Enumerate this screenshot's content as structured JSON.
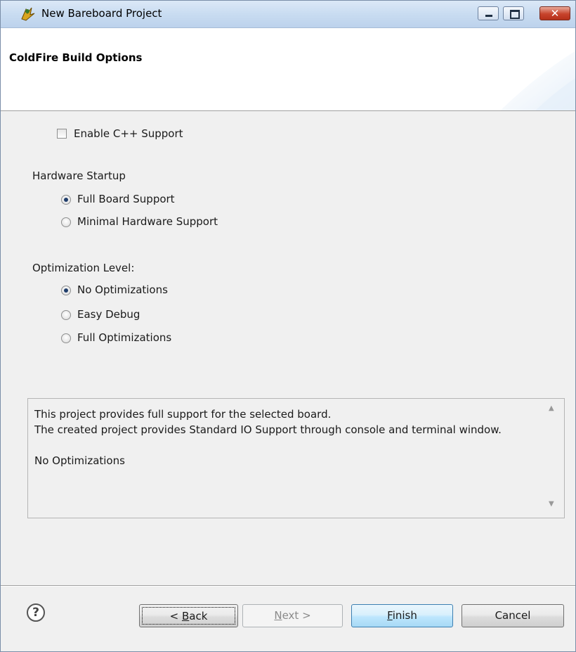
{
  "window": {
    "title": "New Bareboard Project",
    "controls": {
      "minimize": "minimize",
      "maximize": "maximize",
      "close": "✕"
    }
  },
  "header": {
    "title": "ColdFire Build Options"
  },
  "options": {
    "enable_cpp": {
      "label": "Enable C++ Support",
      "checked": false
    },
    "hardware_startup": {
      "heading": "Hardware Startup",
      "choices": [
        {
          "label": "Full Board Support",
          "selected": true
        },
        {
          "label": "Minimal Hardware Support",
          "selected": false
        }
      ]
    },
    "optimization": {
      "heading": "Optimization Level:",
      "choices": [
        {
          "label": "No Optimizations",
          "selected": true
        },
        {
          "label": "Easy Debug",
          "selected": false
        },
        {
          "label": "Full Optimizations",
          "selected": false
        }
      ]
    }
  },
  "description": {
    "lines": [
      "This project provides full support for the selected board.",
      "The created project provides Standard IO Support through console and terminal window.",
      "",
      "No Optimizations"
    ]
  },
  "buttons": {
    "back": {
      "prefix": "< ",
      "mnemonic": "B",
      "rest": "ack"
    },
    "next": {
      "mnemonic": "N",
      "rest": "ext >"
    },
    "finish": {
      "mnemonic": "F",
      "rest": "inish"
    },
    "cancel": "Cancel",
    "help": "?"
  },
  "icons": {
    "app": "project-wizard-icon",
    "help": "help-icon",
    "scroll_up": "scroll-up-icon",
    "scroll_down": "scroll-down-icon"
  },
  "colors": {
    "titlebar": "#c9dcf1",
    "close_button": "#c7432b",
    "default_button": "#bee6fd"
  }
}
